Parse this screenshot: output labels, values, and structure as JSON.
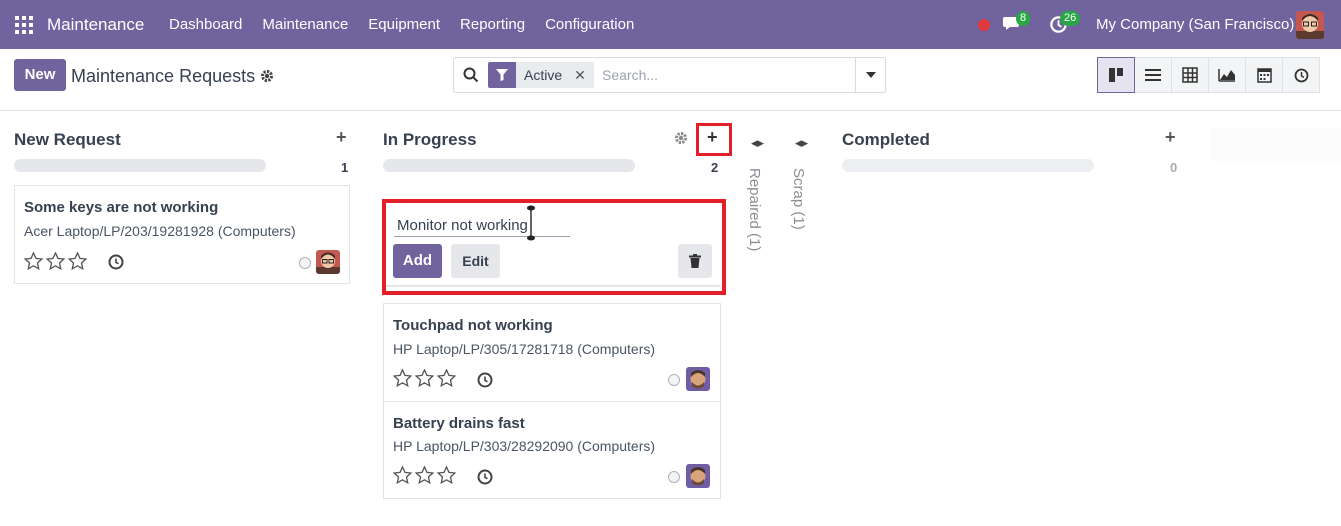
{
  "navbar": {
    "app_name": "Maintenance",
    "menu": [
      "Dashboard",
      "Maintenance",
      "Equipment",
      "Reporting",
      "Configuration"
    ],
    "messages_count": "8",
    "activities_count": "26",
    "company": "My Company (San Francisco)"
  },
  "control_panel": {
    "new_label": "New",
    "breadcrumb": "Maintenance Requests",
    "facet_label": "Active",
    "search_placeholder": "Search...",
    "views": [
      "kanban-icon",
      "list-icon",
      "pivot-icon",
      "graph-icon",
      "calendar-icon",
      "activity-icon"
    ]
  },
  "columns": [
    {
      "title": "New Request",
      "count": "1",
      "cards": [
        {
          "title": "Some keys are not working",
          "subtitle": "Acer Laptop/LP/203/19281928 (Computers)"
        }
      ]
    },
    {
      "title": "In Progress",
      "count": "2",
      "quick_create": {
        "value": "Monitor not working",
        "add_label": "Add",
        "edit_label": "Edit"
      },
      "cards": [
        {
          "title": "Touchpad not working",
          "subtitle": "HP Laptop/LP/305/17281718 (Computers)"
        },
        {
          "title": "Battery drains fast",
          "subtitle": "HP Laptop/LP/303/28292090 (Computers)"
        }
      ]
    },
    {
      "title": "Repaired (1)",
      "folded": true
    },
    {
      "title": "Scrap (1)",
      "folded": true
    },
    {
      "title": "Completed",
      "count": "0",
      "cards": []
    }
  ],
  "colors": {
    "brand": "#71639e",
    "highlight": "#e3202a",
    "badge": "#28a745"
  }
}
